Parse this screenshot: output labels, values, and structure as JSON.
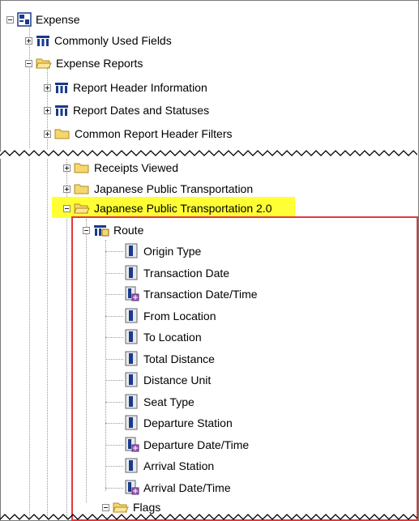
{
  "tree": {
    "root": {
      "label": "Expense",
      "icon": "data-source-icon"
    },
    "top_items": [
      {
        "label": "Commonly Used Fields",
        "icon": "field-table-icon",
        "expanded": false
      },
      {
        "label": "Expense Reports",
        "icon": "folder-open-icon",
        "expanded": true
      }
    ],
    "report_children": [
      {
        "label": "Report Header Information",
        "icon": "field-table-icon"
      },
      {
        "label": "Report Dates and Statuses",
        "icon": "field-table-icon"
      },
      {
        "label": "Common Report Header Filters",
        "icon": "folder-icon"
      }
    ],
    "lower_items": [
      {
        "label": "Receipts Viewed",
        "icon": "folder-icon"
      },
      {
        "label": "Japanese Public Transportation",
        "icon": "folder-icon"
      },
      {
        "label": "Japanese Public Transportation 2.0",
        "icon": "folder-open-icon",
        "highlighted": true
      }
    ],
    "route": {
      "label": "Route",
      "icon": "query-subject-icon",
      "fields": [
        {
          "label": "Origin Type",
          "icon": "attribute-icon"
        },
        {
          "label": "Transaction Date",
          "icon": "attribute-icon"
        },
        {
          "label": "Transaction Date/Time",
          "icon": "date-time-icon"
        },
        {
          "label": "From Location",
          "icon": "attribute-icon"
        },
        {
          "label": "To Location",
          "icon": "attribute-icon"
        },
        {
          "label": "Total Distance",
          "icon": "attribute-icon"
        },
        {
          "label": "Distance Unit",
          "icon": "attribute-icon"
        },
        {
          "label": "Seat Type",
          "icon": "attribute-icon"
        },
        {
          "label": "Departure Station",
          "icon": "attribute-icon"
        },
        {
          "label": "Departure Date/Time",
          "icon": "date-time-icon"
        },
        {
          "label": "Arrival Station",
          "icon": "attribute-icon"
        },
        {
          "label": "Arrival Date/Time",
          "icon": "date-time-icon"
        }
      ]
    },
    "flags": {
      "label": "Flags",
      "icon": "folder-open-icon"
    }
  },
  "colors": {
    "highlight": "#ffff33",
    "callout_border": "#e03a3a",
    "folder": "#f5d76e"
  }
}
